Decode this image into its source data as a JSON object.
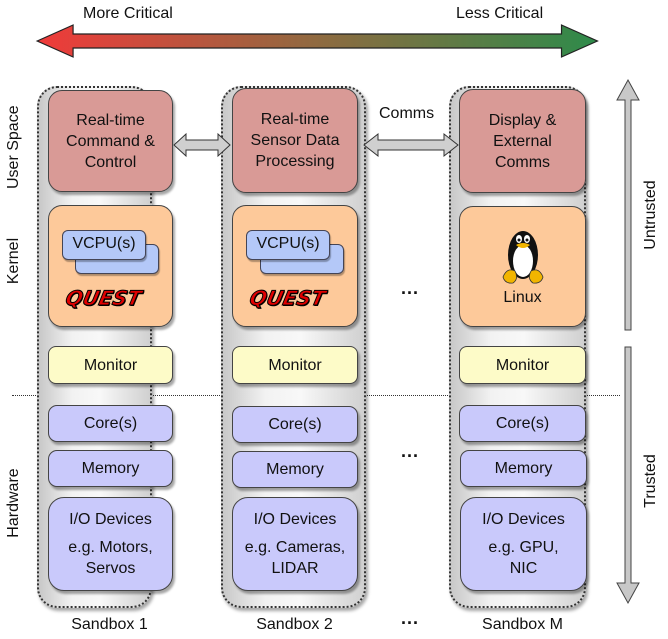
{
  "criticality": {
    "left_label": "More Critical",
    "right_label": "Less Critical",
    "left_color": "#f03a3a",
    "right_color": "#2e8b4a"
  },
  "layers": {
    "user_space": "User Space",
    "kernel": "Kernel",
    "hardware": "Hardware"
  },
  "trust": {
    "untrusted": "Untrusted",
    "trusted": "Trusted"
  },
  "comms_label": "Comms",
  "ellipsis": "...",
  "sandboxes": [
    {
      "name": "Sandbox 1",
      "user_lines": [
        "Real-time",
        "Command &",
        "Control"
      ],
      "kernel_vcpu": "VCPU(s)",
      "kernel_os": "QUEST",
      "monitor": "Monitor",
      "cores": "Core(s)",
      "memory": "Memory",
      "io_title": "I/O Devices",
      "io_lines": [
        "e.g. Motors,",
        "Servos"
      ]
    },
    {
      "name": "Sandbox 2",
      "user_lines": [
        "Real-time",
        "Sensor Data",
        "Processing"
      ],
      "kernel_vcpu": "VCPU(s)",
      "kernel_os": "QUEST",
      "monitor": "Monitor",
      "cores": "Core(s)",
      "memory": "Memory",
      "io_title": "I/O Devices",
      "io_lines": [
        "e.g. Cameras,",
        "LIDAR"
      ]
    },
    {
      "name": "Sandbox M",
      "user_lines": [
        "Display &",
        "External",
        "Comms"
      ],
      "kernel_icon": "linux-penguin-icon",
      "kernel_os": "Linux",
      "monitor": "Monitor",
      "cores": "Core(s)",
      "memory": "Memory",
      "io_title": "I/O Devices",
      "io_lines": [
        "e.g. GPU,",
        "NIC"
      ]
    }
  ],
  "colors": {
    "user_space_box": "#d99a96",
    "kernel_box": "#fdc99a",
    "monitor_box": "#fdfbc8",
    "hardware_box": "#c9c9fb",
    "vcpu_box": "#b4c8f8",
    "quest_logo": "#e00000"
  }
}
